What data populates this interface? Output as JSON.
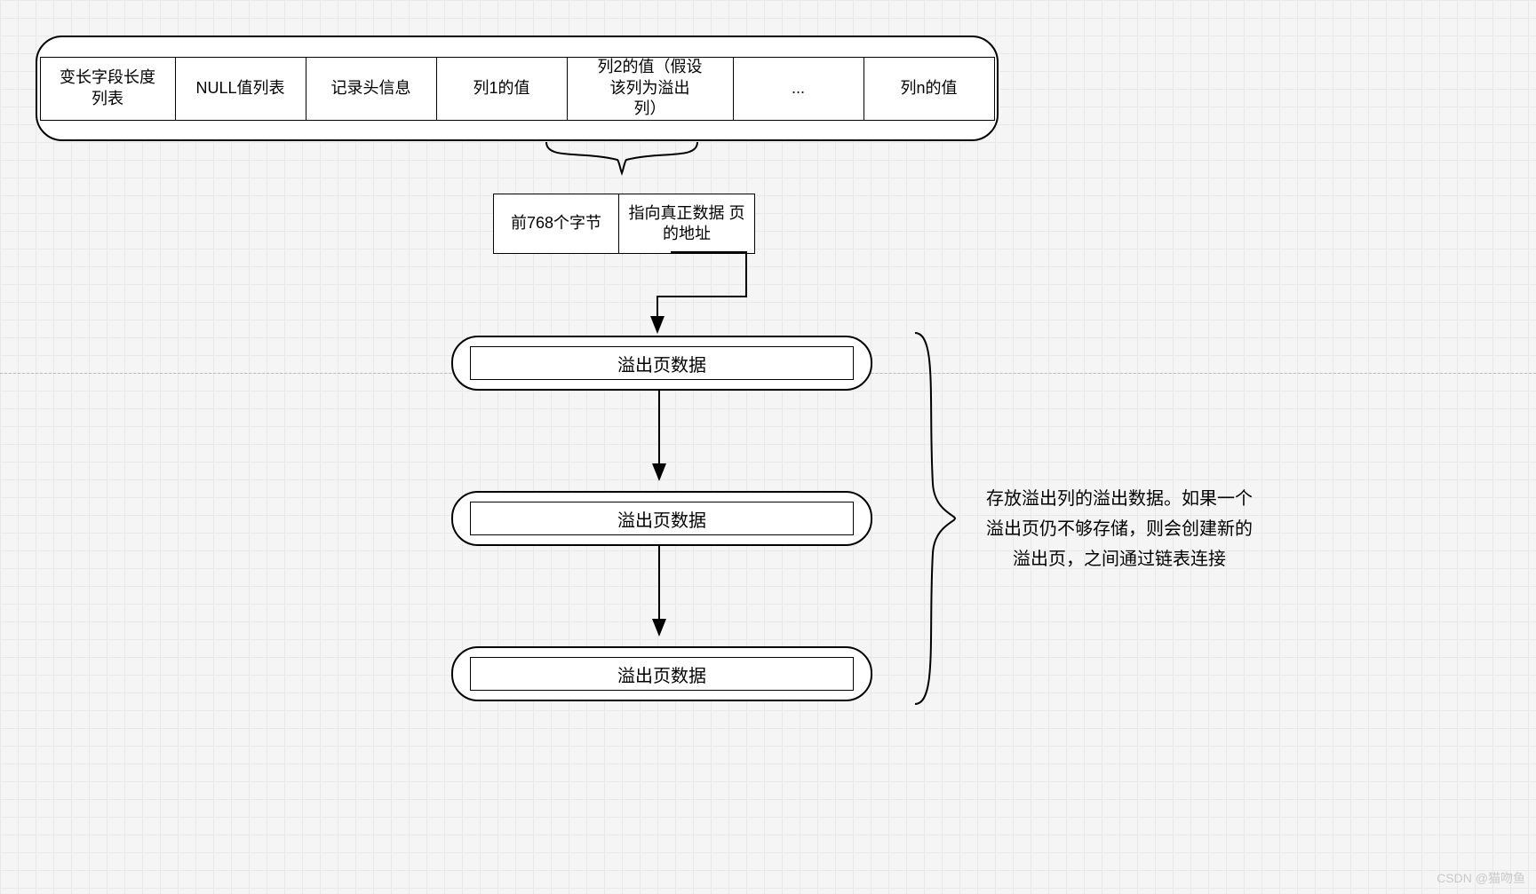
{
  "record_cells": [
    "变长字段长度\n列表",
    "NULL值列表",
    "记录头信息",
    "列1的值",
    "列2的值（假设\n该列为溢出\n列）",
    "...",
    "列n的值"
  ],
  "sub_cells": [
    "前768个字节",
    "指向真正数据\n页的地址"
  ],
  "overflow_pages": [
    "溢出页数据",
    "溢出页数据",
    "溢出页数据"
  ],
  "annotation_lines": [
    "存放溢出列的溢出数据。如果一个",
    "溢出页仍不够存储，则会创建新的",
    "溢出页，之间通过链表连接"
  ],
  "watermark": "CSDN @猫吻鱼"
}
